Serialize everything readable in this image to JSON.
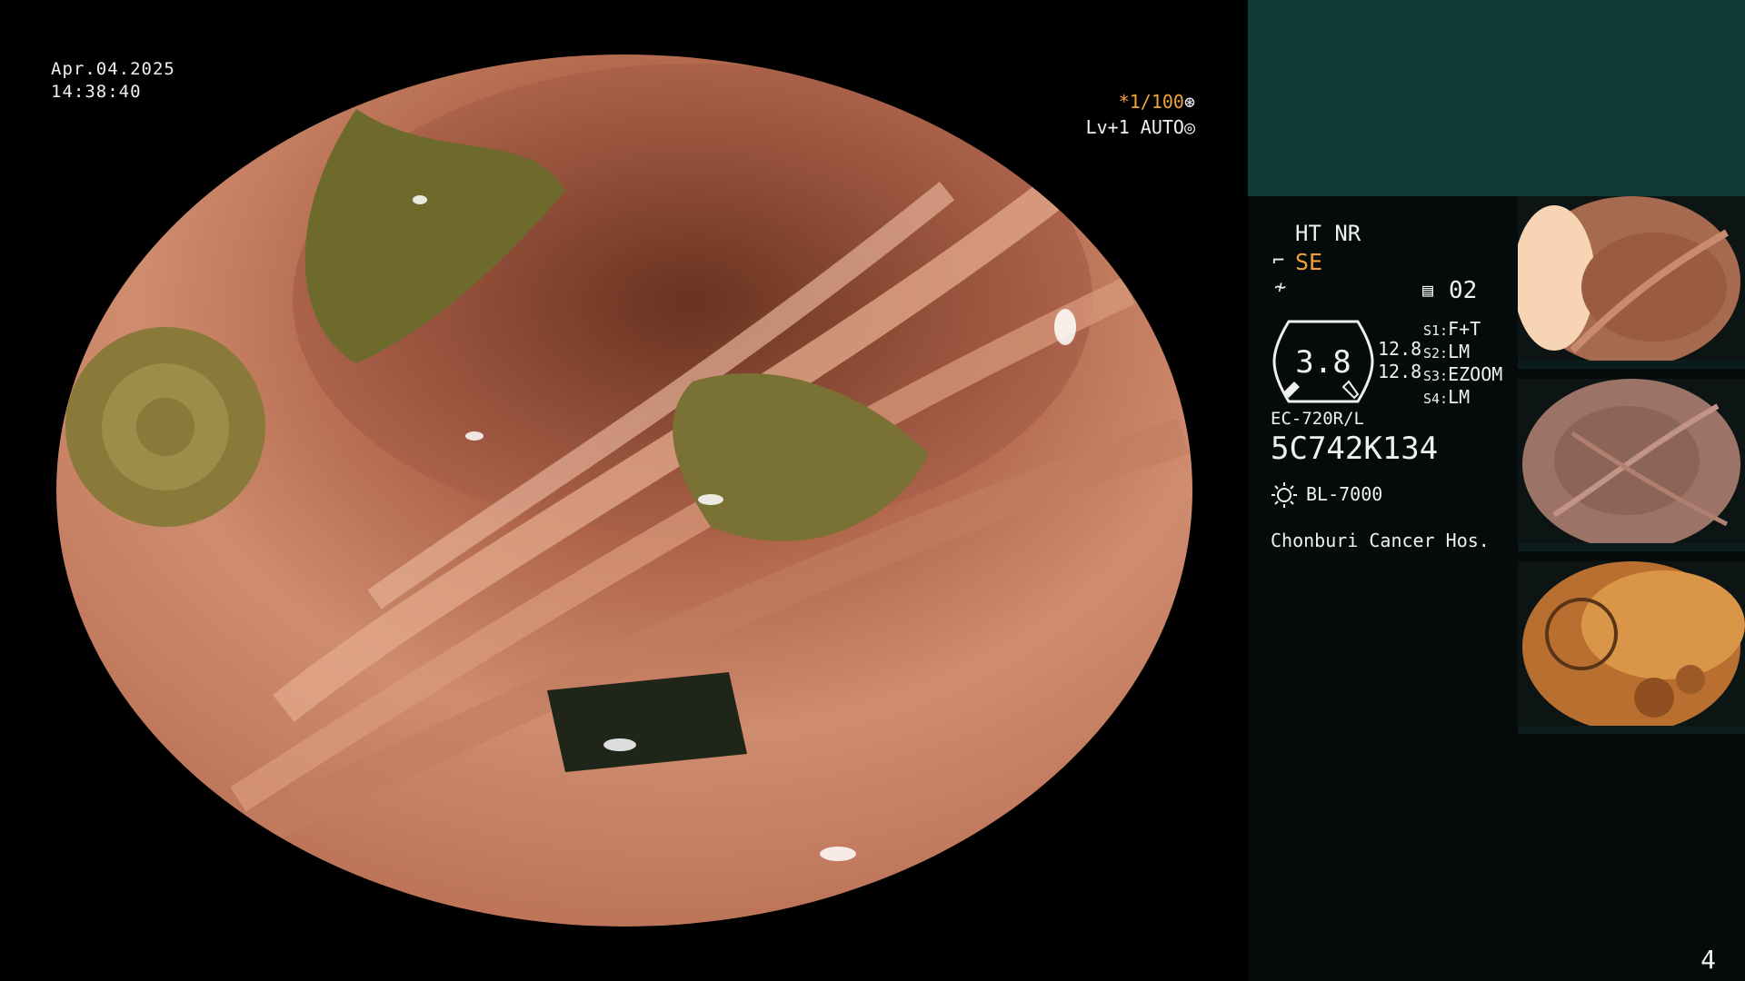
{
  "overlay": {
    "date": "Apr.04.2025",
    "time": "14:38:40",
    "shutter": "*1/100",
    "shutter_icon": "aperture-icon",
    "level": "Lv+1 AUTO",
    "level_icon": "target-icon"
  },
  "panel": {
    "enhance": "HT NR",
    "structure": "SE",
    "memory_label": "02",
    "zoom": "3.8",
    "value_top": "12.8",
    "value_bottom": "12.8",
    "switches": [
      {
        "label": "S1:",
        "value": "F+T"
      },
      {
        "label": "S2:",
        "value": "LM"
      },
      {
        "label": "S3:",
        "value": "EZOOM"
      },
      {
        "label": "S4:",
        "value": "LM"
      }
    ],
    "scope_model": "EC-720R/L",
    "serial": "5C742K134",
    "light_source": "BL-7000",
    "hospital": "Chonburi Cancer Hos.",
    "page": "4"
  },
  "colors": {
    "accent_orange": "#f0a23a",
    "panel_header": "#0e3a38",
    "panel_bg": "#050b0b"
  }
}
